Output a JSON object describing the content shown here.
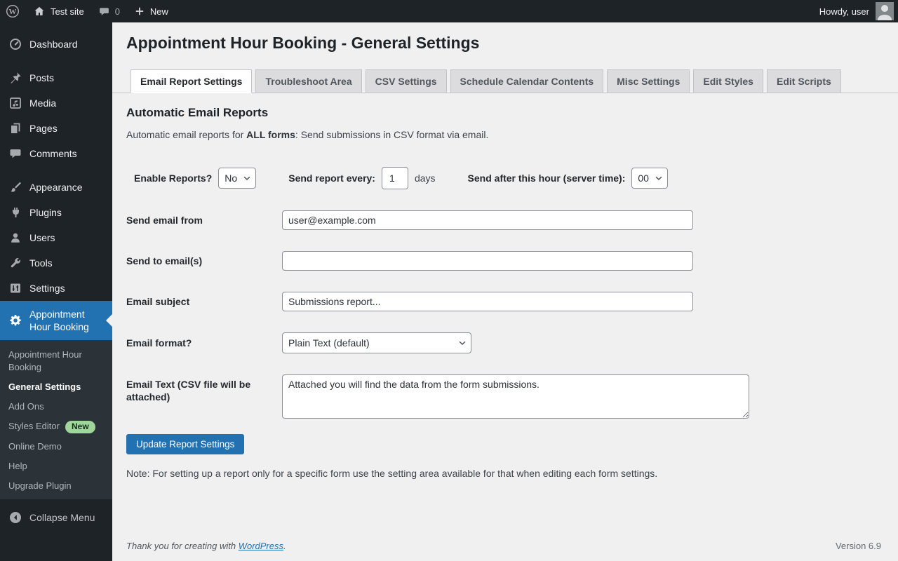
{
  "admin_bar": {
    "site_name": "Test site",
    "comment_count": "0",
    "new_label": "New",
    "howdy": "Howdy, user"
  },
  "sidebar": {
    "items": [
      {
        "label": "Dashboard"
      },
      {
        "label": "Posts"
      },
      {
        "label": "Media"
      },
      {
        "label": "Pages"
      },
      {
        "label": "Comments"
      },
      {
        "label": "Appearance"
      },
      {
        "label": "Plugins"
      },
      {
        "label": "Users"
      },
      {
        "label": "Tools"
      },
      {
        "label": "Settings"
      },
      {
        "label": "Appointment Hour Booking"
      }
    ],
    "submenu": [
      {
        "label": "Appointment Hour Booking"
      },
      {
        "label": "General Settings"
      },
      {
        "label": "Add Ons"
      },
      {
        "label": "Styles Editor",
        "badge": "New"
      },
      {
        "label": "Online Demo"
      },
      {
        "label": "Help"
      },
      {
        "label": "Upgrade Plugin"
      }
    ],
    "collapse": "Collapse Menu"
  },
  "page": {
    "title": "Appointment Hour Booking - General Settings",
    "tabs": [
      {
        "label": "Email Report Settings"
      },
      {
        "label": "Troubleshoot Area"
      },
      {
        "label": "CSV Settings"
      },
      {
        "label": "Schedule Calendar Contents"
      },
      {
        "label": "Misc Settings"
      },
      {
        "label": "Edit Styles"
      },
      {
        "label": "Edit Scripts"
      }
    ],
    "section_title": "Automatic Email Reports",
    "intro_prefix": "Automatic email reports for ",
    "intro_bold": "ALL forms",
    "intro_suffix": ": Send submissions in CSV format via email.",
    "controls": {
      "enable_label": "Enable Reports?",
      "enable_value": "No",
      "every_label": "Send report every:",
      "every_value": "1",
      "every_unit": "days",
      "hour_label": "Send after this hour (server time):",
      "hour_value": "00"
    },
    "form": {
      "from_label": "Send email from",
      "from_value": "user@example.com",
      "to_label": "Send to email(s)",
      "to_value": "",
      "subject_label": "Email subject",
      "subject_value": "Submissions report...",
      "format_label": "Email format?",
      "format_value": "Plain Text (default)",
      "text_label": "Email Text (CSV file will be attached)",
      "text_value": "Attached you will find the data from the form submissions."
    },
    "submit_label": "Update Report Settings",
    "note": "Note: For setting up a report only for a specific form use the setting area available for that when editing each form settings."
  },
  "footer": {
    "thanks_prefix": "Thank you for creating with ",
    "link_label": "WordPress",
    "thanks_suffix": ".",
    "version": "Version 6.9"
  }
}
